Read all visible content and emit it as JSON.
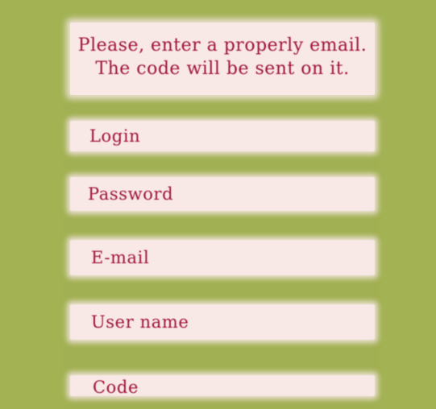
{
  "notice": {
    "line1": "Please, enter a properly email.",
    "line2": "The code will be sent on it."
  },
  "form": {
    "login_placeholder": "Login",
    "password_placeholder": "Password",
    "email_placeholder": "E-mail",
    "username_placeholder": "User name",
    "code_placeholder": "Code"
  },
  "colors": {
    "background": "#a3b354",
    "field_background": "#f8e8e6",
    "text": "#a0143c"
  }
}
